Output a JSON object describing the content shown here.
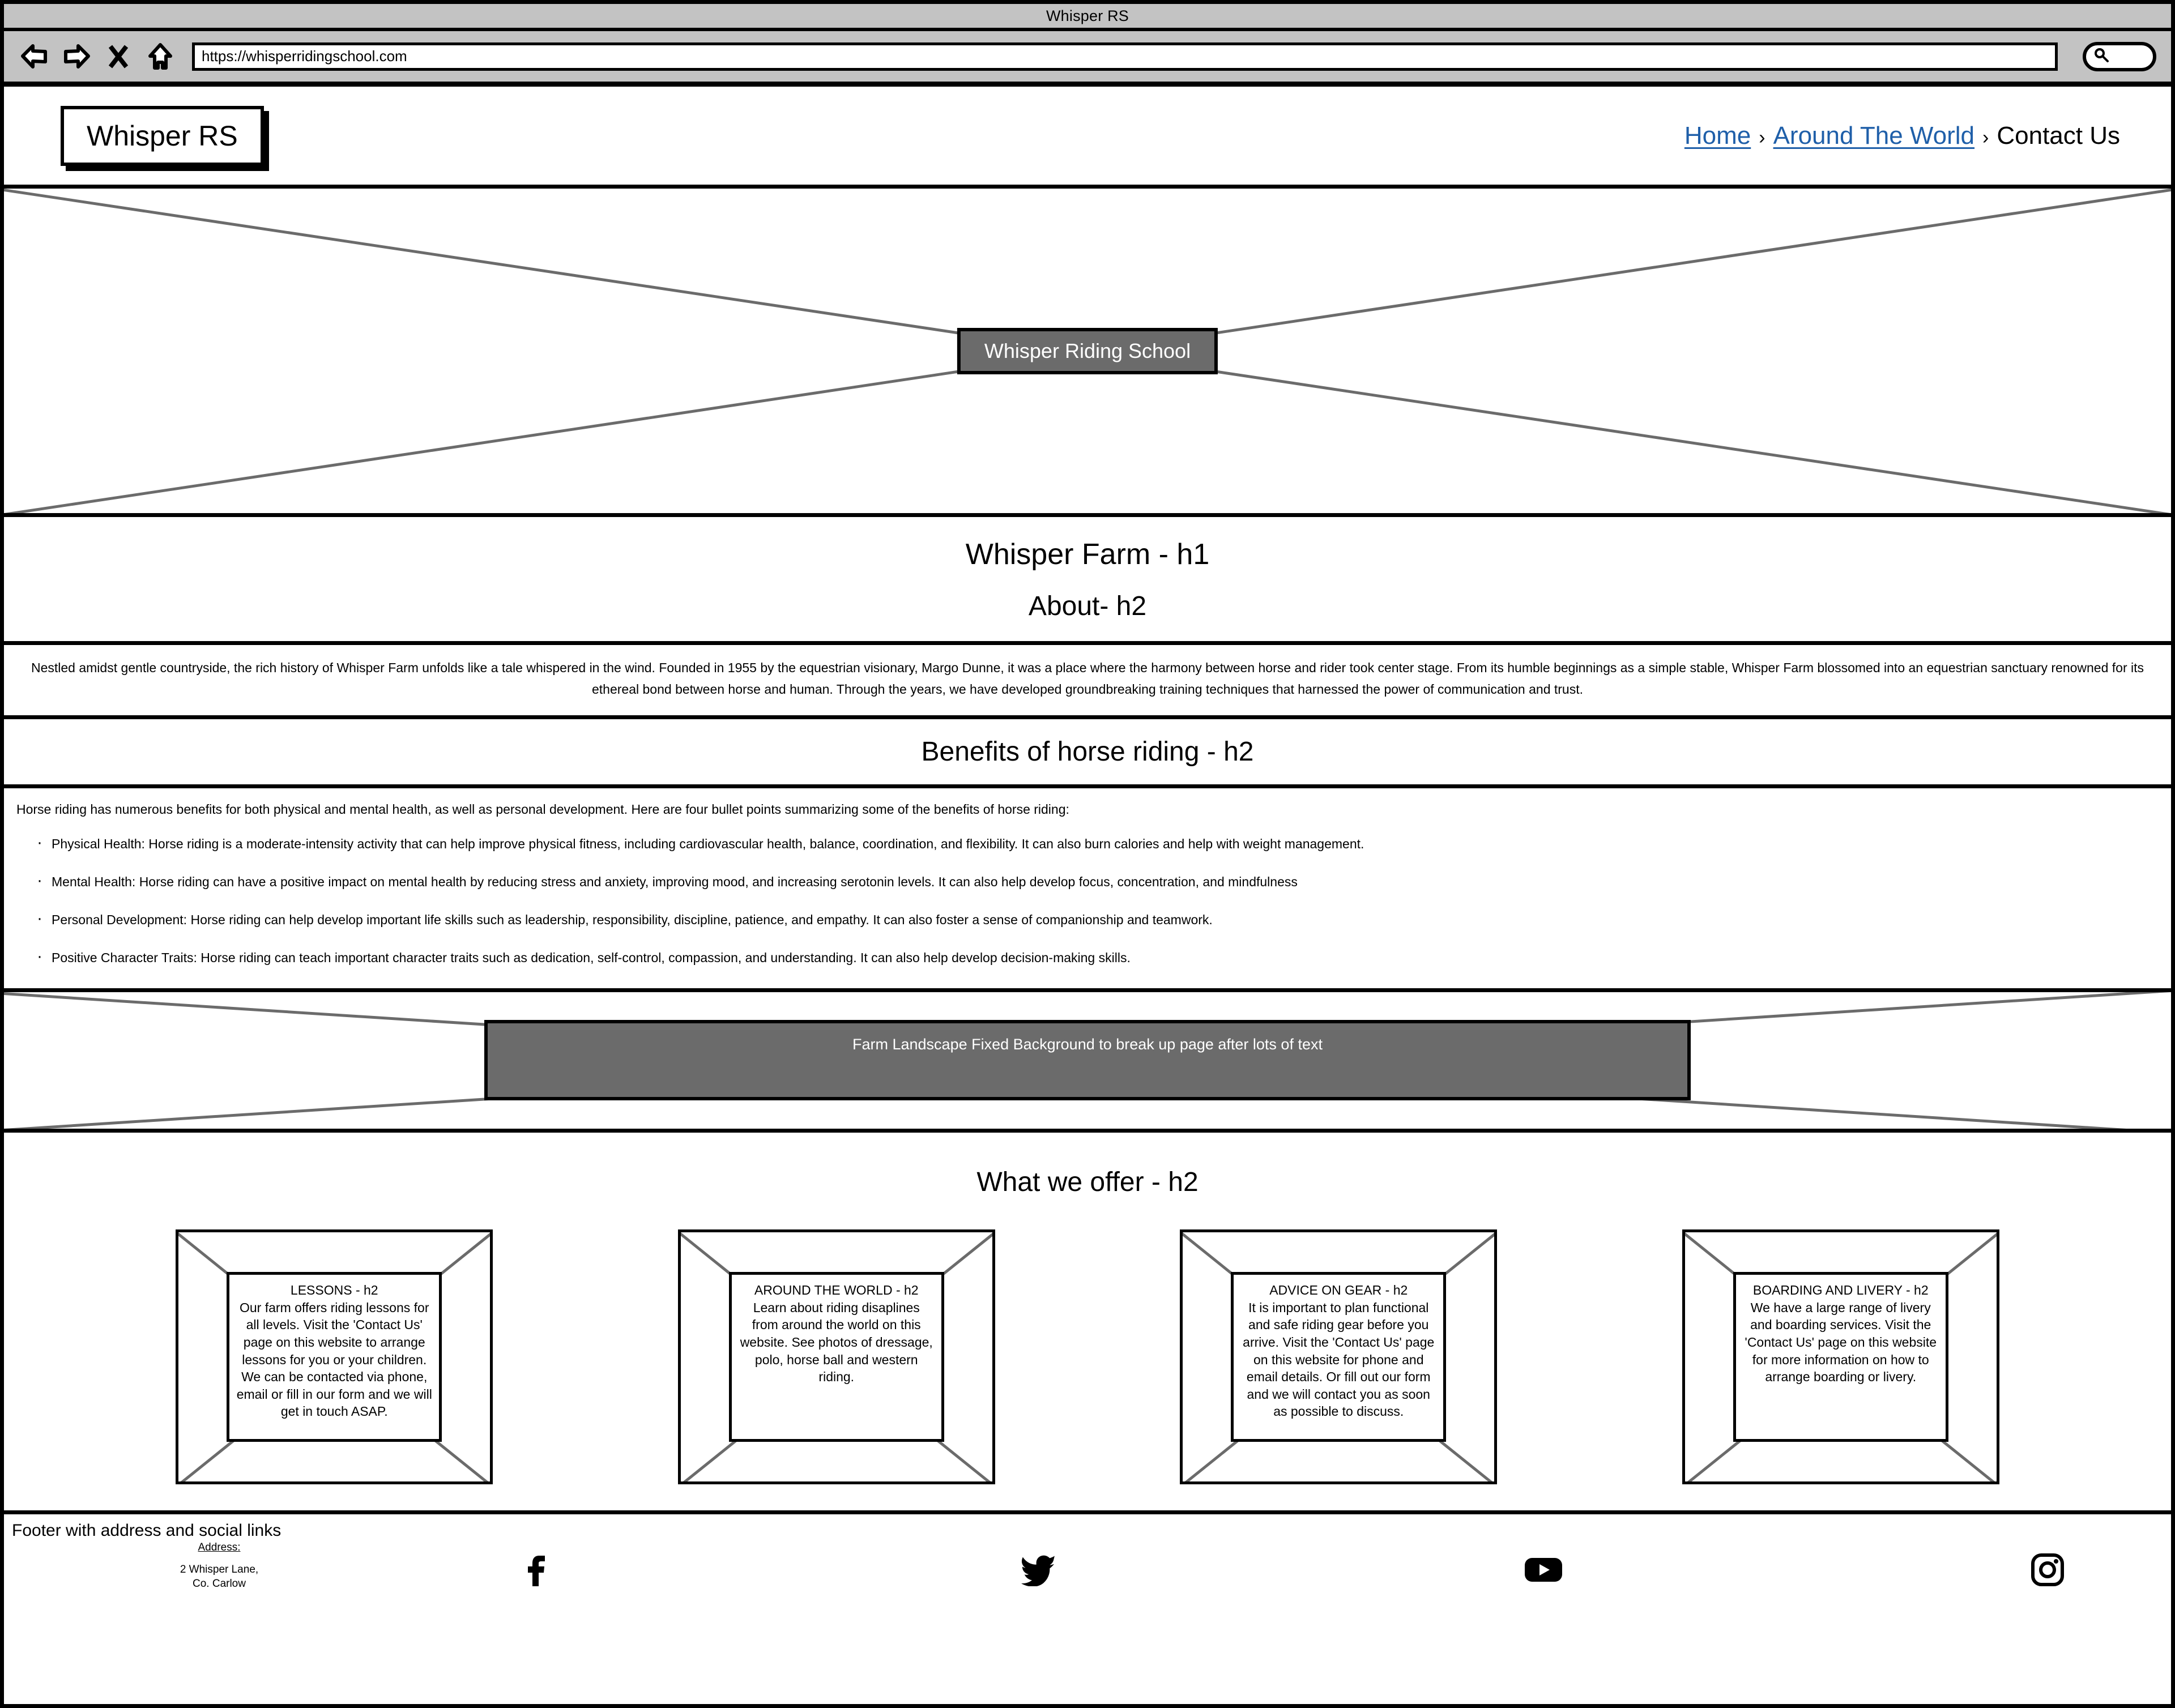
{
  "browser": {
    "window_title": "Whisper RS",
    "url": "https://whisperridingschool.com",
    "back_icon": "back-arrow-icon",
    "forward_icon": "forward-arrow-icon",
    "stop_icon": "close-x-icon",
    "home_icon": "home-icon",
    "search_icon": "search-icon",
    "search_value": ""
  },
  "site_header": {
    "logo": "Whisper RS",
    "breadcrumb": {
      "items": [
        {
          "label": "Home",
          "link": true
        },
        {
          "label": "Around The World",
          "link": true
        },
        {
          "label": "Contact Us",
          "link": false
        }
      ],
      "separator": "›"
    }
  },
  "hero": {
    "caption": "Whisper Riding School",
    "placeholder_kind": "image-placeholder"
  },
  "headings": {
    "h1": "Whisper Farm - h1",
    "h2": "About- h2"
  },
  "about": {
    "paragraph": "Nestled amidst gentle countryside, the rich history of Whisper Farm unfolds like a tale whispered in the wind. Founded in 1955 by the equestrian visionary, Margo Dunne, it was a place where the harmony between horse and rider took center stage. From its humble beginnings as a simple stable, Whisper Farm blossomed into an equestrian sanctuary renowned for its ethereal bond between horse and human. Through the years, we have developed groundbreaking training techniques that harnessed the power of communication and trust."
  },
  "benefits": {
    "heading": "Benefits of horse riding - h2",
    "lead": "Horse riding has numerous benefits for both physical and mental health, as well as personal development. Here are four bullet points summarizing some of the benefits of horse riding:",
    "bullets": [
      "Physical Health: Horse riding is a moderate-intensity activity that can help improve physical fitness, including cardiovascular health, balance, coordination, and flexibility. It can also burn calories and help with weight management.",
      "Mental Health: Horse riding can have a positive impact on mental health by reducing stress and anxiety, improving mood, and increasing serotonin levels. It can also help develop focus, concentration, and mindfulness",
      "Personal Development: Horse riding can help develop important life skills such as leadership, responsibility, discipline, patience, and empathy. It can also foster a sense of companionship and teamwork.",
      "Positive Character Traits: Horse riding can teach important character traits such as dedication, self-control, compassion, and understanding. It can also help develop decision-making skills."
    ]
  },
  "banner": {
    "caption": "Farm Landscape Fixed Background to break up page after lots of text"
  },
  "offer": {
    "heading": "What we offer - h2",
    "cards": [
      {
        "title": "LESSONS - h2",
        "body": "Our farm offers riding lessons for all levels. Visit the 'Contact Us' page on this website to arrange lessons for you or your children. We can be contacted via phone, email or fill in our form and we will get in touch ASAP."
      },
      {
        "title": "AROUND THE WORLD - h2",
        "body": "Learn about riding disaplines from around the world on this website. See photos of dressage, polo, horse ball and western riding."
      },
      {
        "title": "ADVICE ON GEAR - h2",
        "body": "It is important to plan functional and safe riding gear before you arrive. Visit the 'Contact Us' page on this website for phone and email details. Or fill out our form and we will contact you as soon as possible to discuss."
      },
      {
        "title": "BOARDING AND LIVERY - h2",
        "body": "We have a large range of livery and boarding services. Visit the 'Contact Us' page on this website for more information on how to arrange boarding or livery."
      }
    ]
  },
  "footer": {
    "label": "Footer with address and social links",
    "address_label": "Address:",
    "address_line1": "2 Whisper Lane,",
    "address_line2": "Co. Carlow",
    "socials": [
      {
        "name": "facebook-icon"
      },
      {
        "name": "twitter-icon"
      },
      {
        "name": "youtube-icon"
      },
      {
        "name": "instagram-icon"
      }
    ]
  },
  "colors": {
    "chrome": "#c3c3c3",
    "placeholder_fill": "#6b6b6b",
    "link": "#1f5fa9",
    "line": "#000000"
  }
}
